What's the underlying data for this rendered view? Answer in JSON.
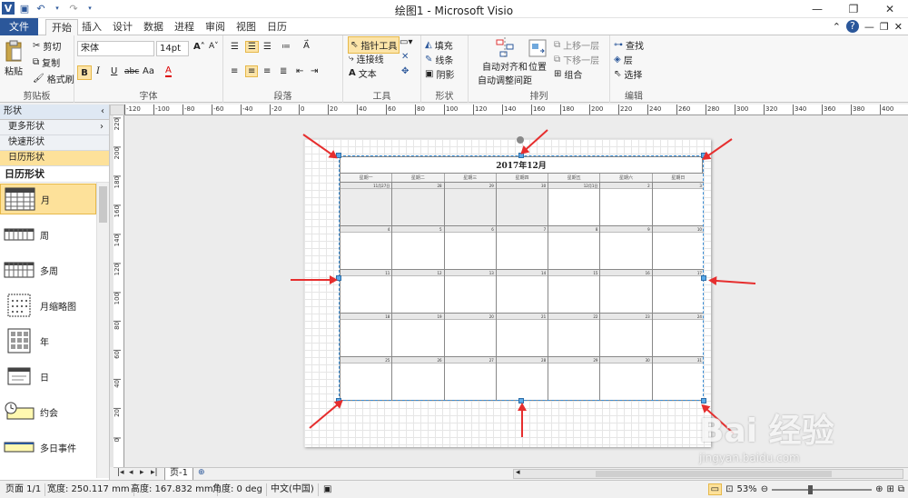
{
  "window": {
    "title": "绘图1 - Microsoft Visio"
  },
  "quick_access": {
    "icons": [
      "visio-icon",
      "save-icon",
      "undo-icon",
      "redo-icon",
      "customize-icon"
    ]
  },
  "ribbon_tabs": [
    "文件",
    "开始",
    "插入",
    "设计",
    "数据",
    "进程",
    "审阅",
    "视图",
    "日历"
  ],
  "ribbon": {
    "clipboard": {
      "paste": "粘贴",
      "cut": "剪切",
      "copy": "复制",
      "format_painter": "格式刷",
      "label": "剪贴板"
    },
    "font": {
      "family": "宋体",
      "size": "14pt",
      "label": "字体",
      "bold": "B",
      "italic": "I",
      "underline": "U",
      "strike": "abc",
      "case": "Aa",
      "color": "A"
    },
    "paragraph": {
      "label": "段落"
    },
    "tools": {
      "pointer": "指针工具",
      "connector": "连接线",
      "text": "文本",
      "label": "工具"
    },
    "shape": {
      "fill": "填充",
      "line": "线条",
      "shadow": "阴影",
      "label": "形状"
    },
    "arrange": {
      "auto_align": "自动对齐和",
      "auto_space": "自动调整间距",
      "position": "位置",
      "bring_forward": "上移一层",
      "send_backward": "下移一层",
      "group": "组合",
      "label": "排列"
    },
    "editing": {
      "find": "查找",
      "layer": "层",
      "select": "选择",
      "label": "编辑"
    }
  },
  "shapes_pane": {
    "header": "形状",
    "more": "更多形状",
    "quick": "快速形状",
    "calendar": "日历形状",
    "stencil_title": "日历形状",
    "items": [
      "月",
      "周",
      "多周",
      "月缩略图",
      "年",
      "日",
      "约会",
      "多日事件"
    ]
  },
  "ruler": {
    "top_ticks": [
      "-120",
      "-100",
      "-80",
      "-60",
      "-40",
      "-20",
      "0",
      "20",
      "40",
      "60",
      "80",
      "100",
      "120",
      "140",
      "160",
      "180",
      "200",
      "220",
      "240",
      "260",
      "280",
      "300",
      "320",
      "340",
      "360",
      "380",
      "400"
    ],
    "left_ticks": [
      "220",
      "200",
      "180",
      "160",
      "140",
      "120",
      "100",
      "80",
      "60",
      "40",
      "20",
      "0"
    ]
  },
  "calendar": {
    "title": "2017年12月",
    "weekdays": [
      "星期一",
      "星期二",
      "星期三",
      "星期四",
      "星期五",
      "星期六",
      "星期日"
    ],
    "weeks": [
      [
        "11月27日",
        "28",
        "29",
        "30",
        "12月1日",
        "2",
        "3"
      ],
      [
        "4",
        "5",
        "6",
        "7",
        "8",
        "9",
        "10"
      ],
      [
        "11",
        "12",
        "13",
        "14",
        "15",
        "16",
        "17"
      ],
      [
        "18",
        "19",
        "20",
        "21",
        "22",
        "23",
        "24"
      ],
      [
        "25",
        "26",
        "27",
        "28",
        "29",
        "30",
        "31"
      ]
    ]
  },
  "page_tabs": {
    "current": "页-1"
  },
  "status": {
    "page": "页面 1/1",
    "width": "宽度: 250.117 mm",
    "height": "高度: 167.832 mm",
    "angle": "角度: 0 deg",
    "language": "中文(中国)",
    "zoom": "53%"
  },
  "watermark": {
    "brand": "Bai 经验",
    "url": "jingyan.baidu.com"
  },
  "colors": {
    "file_tab": "#2b579a",
    "selected": "#fde19a",
    "arrow": "#e62e2e"
  }
}
